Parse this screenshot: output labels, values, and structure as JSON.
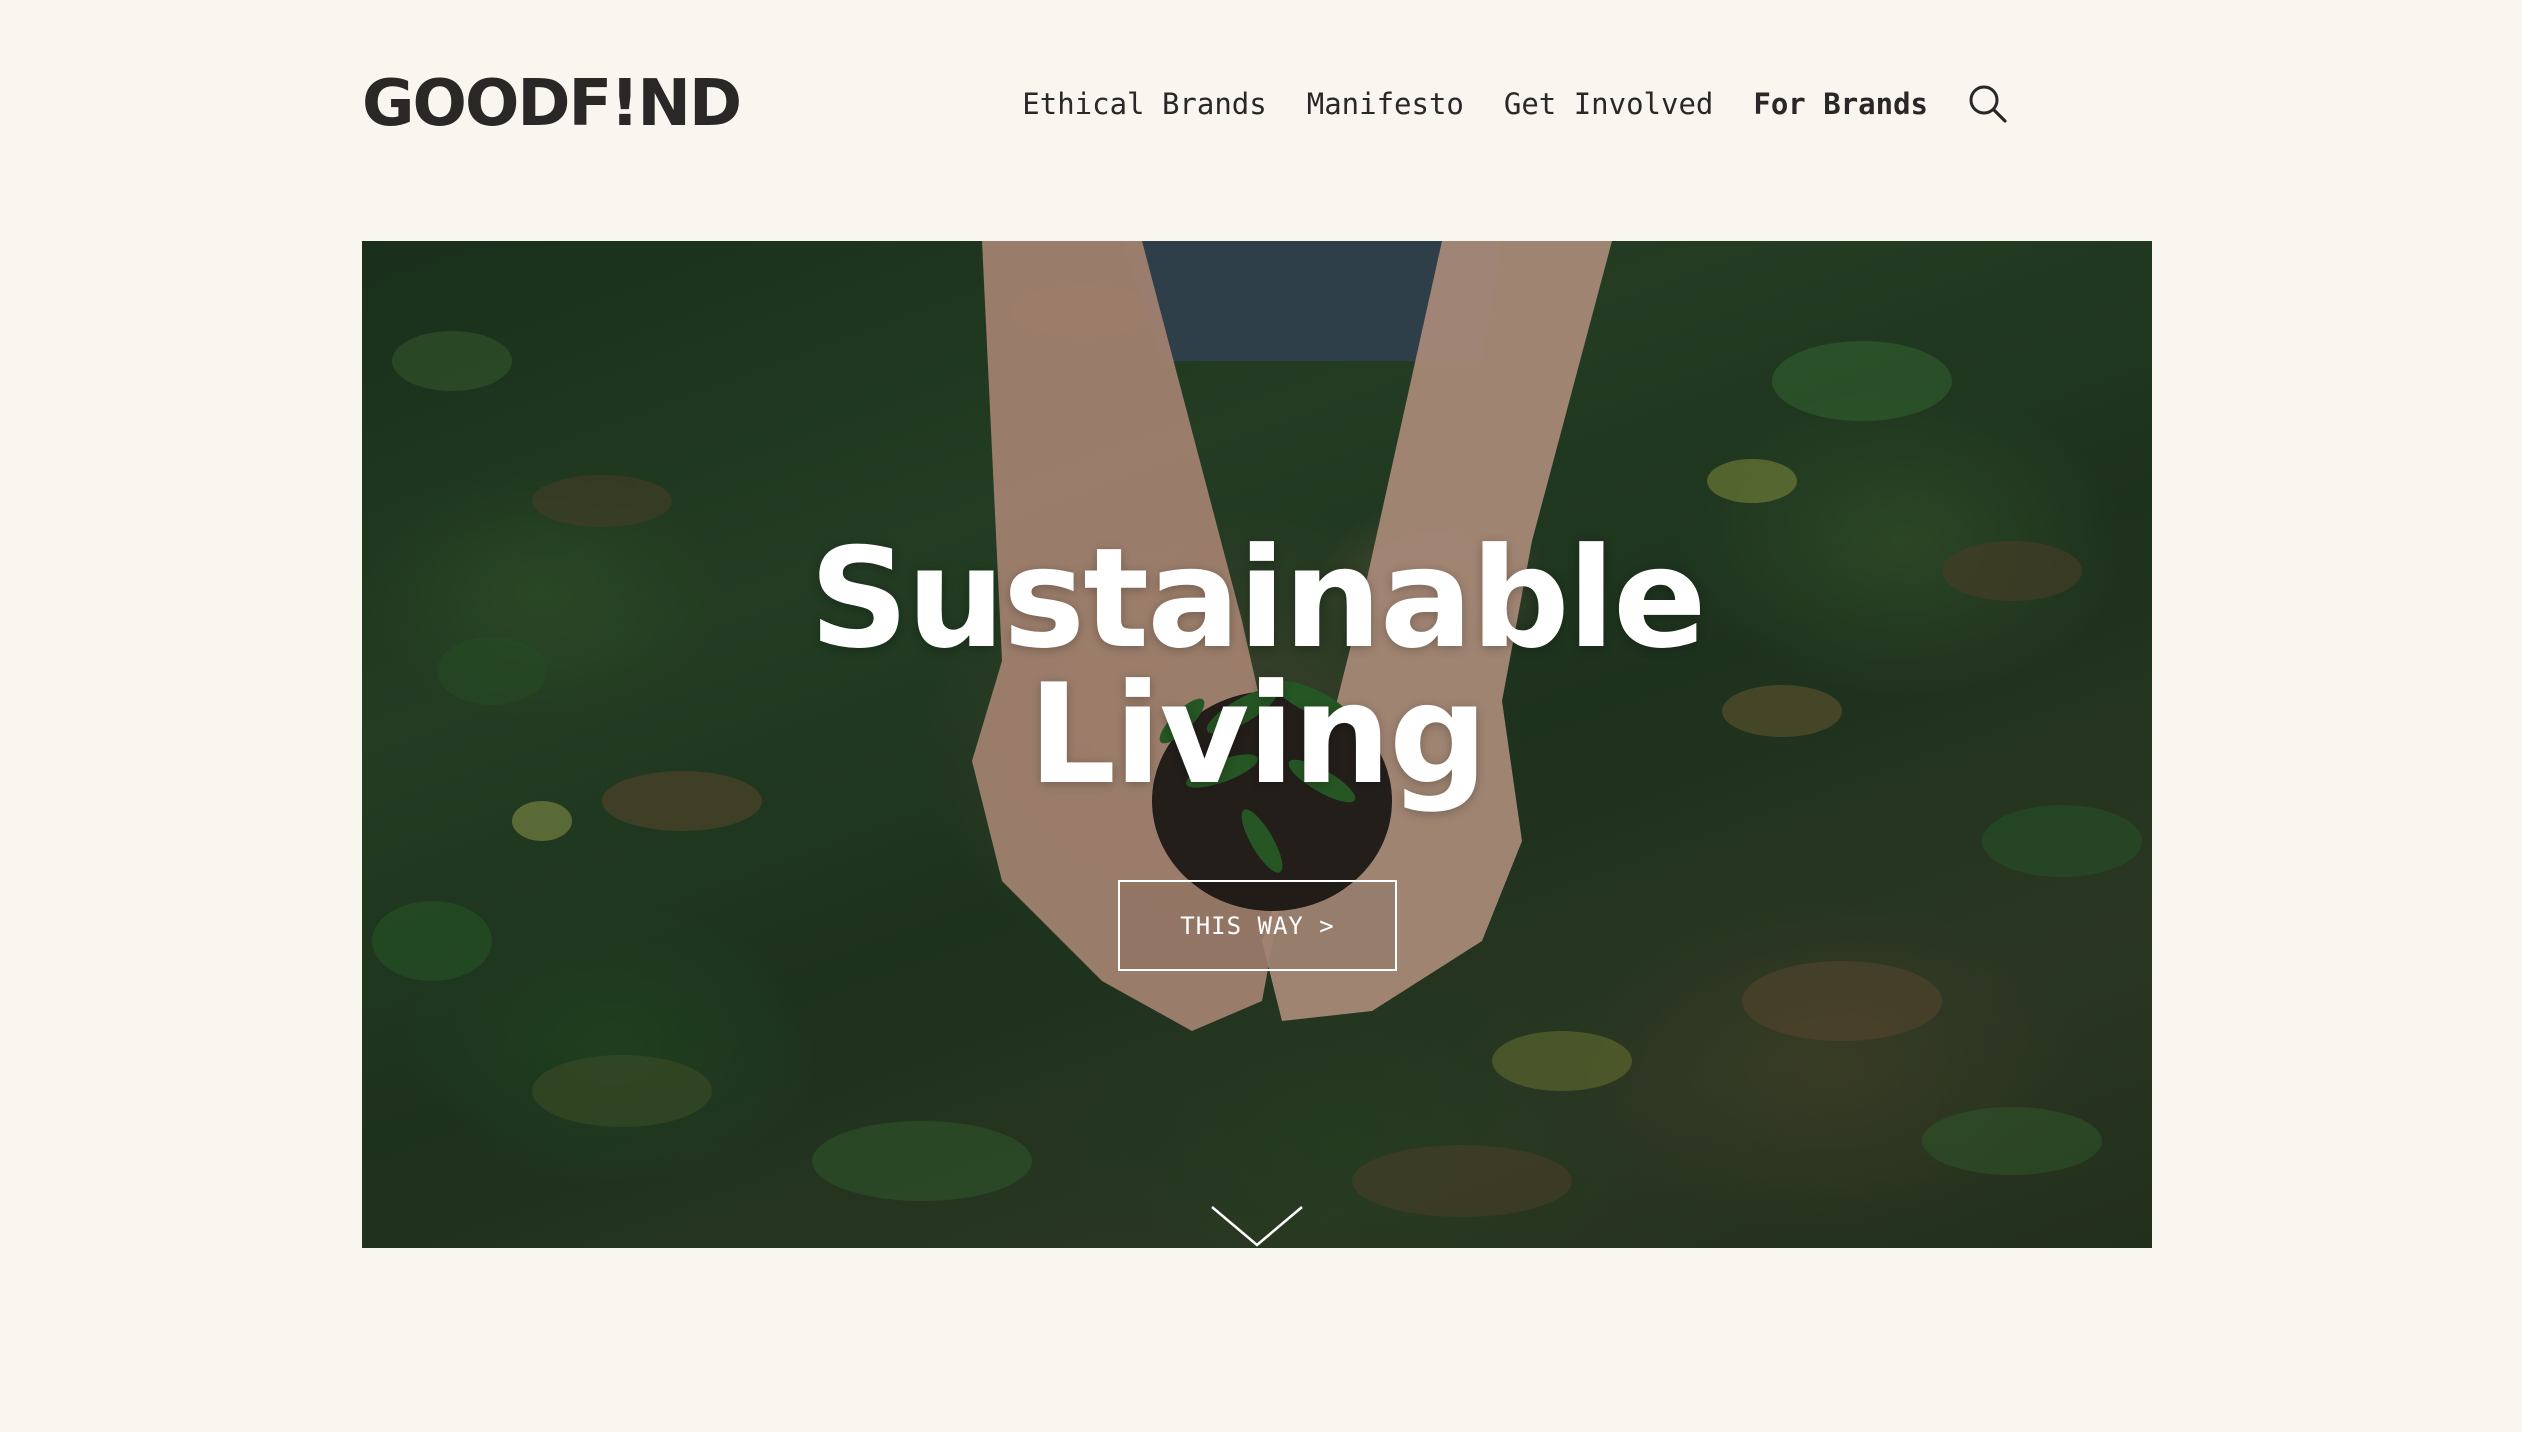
{
  "brand": {
    "logo_text": "GOODF!ND"
  },
  "nav": {
    "items": [
      {
        "label": "Ethical Brands"
      },
      {
        "label": "Manifesto"
      },
      {
        "label": "Get Involved"
      },
      {
        "label": "For Brands"
      }
    ],
    "search_icon": "search-icon"
  },
  "hero": {
    "title_line1": "Sustainable",
    "title_line2": "Living",
    "cta_label": "THIS WAY >",
    "scroll_icon": "chevron-down-icon"
  },
  "colors": {
    "background": "#f9f5ef",
    "text": "#2a2727",
    "hero_text": "#ffffff"
  }
}
